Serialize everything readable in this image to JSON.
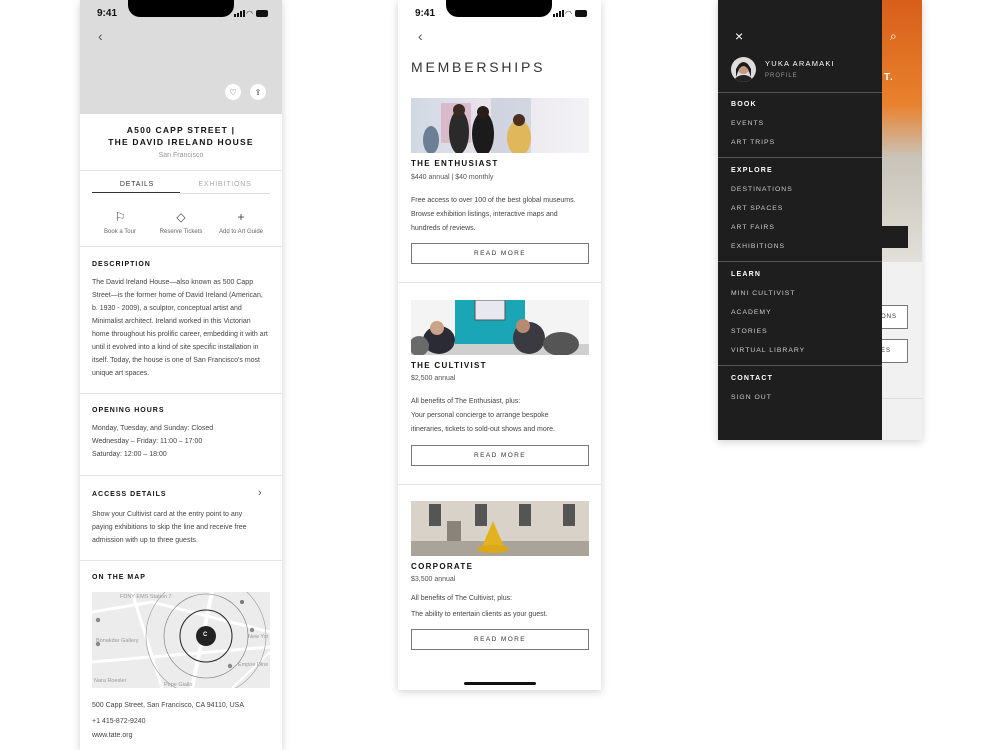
{
  "status": {
    "time": "9:41"
  },
  "detail": {
    "title": "A500 CAPP STREET |\nTHE DAVID IRELAND HOUSE",
    "location": "San Francisco",
    "tabs": [
      "DETAILS",
      "EXHIBITIONS"
    ],
    "actions": [
      {
        "label": "Book a Tour",
        "icon": "flag-icon"
      },
      {
        "label": "Reserve Tickets",
        "icon": "ticket-icon"
      },
      {
        "label": "Add to Art Guide",
        "icon": "plus-icon"
      }
    ],
    "description_heading": "DESCRIPTION",
    "description": "The David Ireland House—also known as 500 Capp Street—is the former home of David Ireland (American, b. 1930 - 2009), a sculptor, conceptual artist and Minimalist architect. Ireland worked in this Victorian home throughout his prolific career, embedding it with art until it evolved into a kind of site specific installation in itself. Today, the house is one of San Francisco's most unique art spaces.",
    "hours_heading": "OPENING HOURS",
    "hours": [
      "Monday, Tuesday, and Sunday: Closed",
      "Wednesday – Friday: 11:00 – 17:00",
      "Saturday: 12:00 – 18:00"
    ],
    "access_heading": "ACCESS DETAILS",
    "access": "Show your Cultivist card at the entry point to any paying exhibitions to skip the line and receive free admission with up to three guests.",
    "map_heading": "ON THE MAP",
    "map_labels": {
      "station": "FDNY EMS Station 7",
      "gallery": "Bonakdar Gallery",
      "roesler": "Nara Roesler",
      "giallo": "Pepe Giallo",
      "newyork": "New Yor",
      "empire": "Empire Dine",
      "marker": "C"
    },
    "address": "500 Capp Street, San Francisco, CA 94110, USA",
    "phone": "+1 415-872-9240",
    "website": "www.tate.org"
  },
  "memberships": {
    "title": "MEMBERSHIPS",
    "read_more": "READ MORE",
    "tiers": [
      {
        "name": "THE ENTHUSIAST",
        "price": "$440 annual | $40 monthly",
        "lines": [
          "Free access to over 100 of the best global museums.",
          "Browse exhibition listings, interactive maps and",
          "hundreds of reviews."
        ]
      },
      {
        "name": "THE CULTIVIST",
        "price": "$2,500 annual",
        "lines": [
          "All benefits of The Enthusiast, plus:",
          "Your personal concierge to arrange bespoke",
          "itineraries, tickets to sold-out shows and more."
        ]
      },
      {
        "name": "CORPORATE",
        "price": "$3,500 annual",
        "lines": [
          "All benefits of The Cultivist, plus:",
          "The ability to entertain clients as your guest."
        ]
      }
    ]
  },
  "menu": {
    "user_name": "YUKA ARAMAKI",
    "user_sub": "PROFILE",
    "sections": [
      {
        "heading": "BOOK",
        "items": [
          "EVENTS",
          "ART TRIPS"
        ]
      },
      {
        "heading": "EXPLORE",
        "items": [
          "DESTINATIONS",
          "ART SPACES",
          "ART FAIRS",
          "EXHIBITIONS"
        ]
      },
      {
        "heading": "LEARN",
        "items": [
          "MINI CULTIVIST",
          "ACADEMY",
          "STORIES",
          "VIRTUAL LIBRARY"
        ]
      },
      {
        "heading": "CONTACT",
        "items": [
          "SIGN OUT"
        ]
      }
    ],
    "behind_text": [
      "T.",
      "ONS",
      "ES"
    ]
  },
  "colors": {
    "drawer": "#1e1e1e",
    "accent_orange": "#e0671f",
    "teal": "#1aa6b7"
  }
}
